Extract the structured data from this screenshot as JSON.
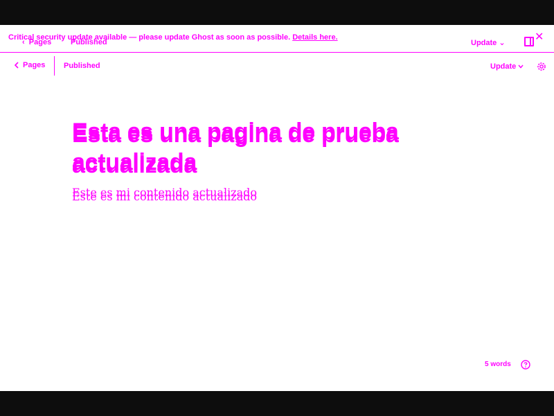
{
  "banner": {
    "message": "Critical security update available — please update Ghost as soon as possible.",
    "link": "Details here.",
    "close_icon": "close-icon"
  },
  "ghost_layer": {
    "back_label": "Pages",
    "status": "Published",
    "update_label": "Update",
    "title": "Esta es una pagina de prueba actualizada",
    "body": "Este es mi contenido actualizado"
  },
  "toolbar": {
    "back_label": "Pages",
    "status": "Published",
    "update_label": "Update",
    "settings_icon": "gear-icon"
  },
  "editor": {
    "title": "Esta es una pagina de prueba actualizada",
    "body": "Este es mi contenido actualizado"
  },
  "footer": {
    "word_count": "5 words",
    "help_icon": "help-icon"
  },
  "colors": {
    "accent": "#ff00ff",
    "frame_background": "#ffffff",
    "outer_background": "#0d0d0d"
  }
}
